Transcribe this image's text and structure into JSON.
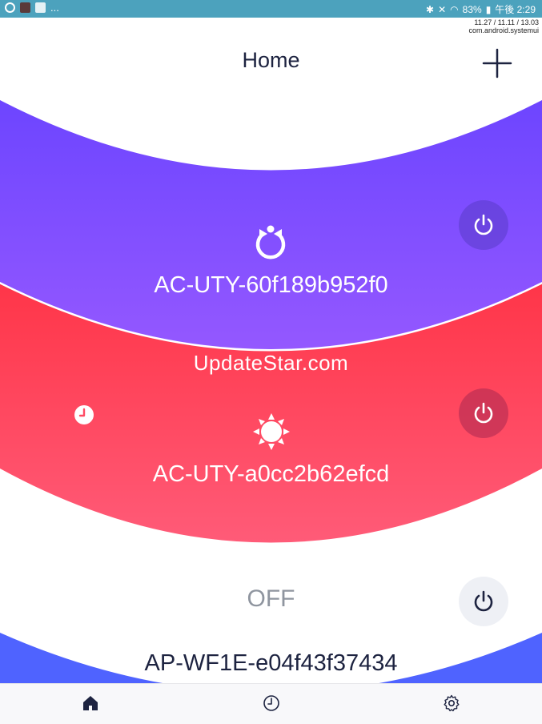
{
  "status_bar": {
    "left_more": "...",
    "battery": "83%",
    "clock": "午後 2:29"
  },
  "overlay": {
    "line1": "11.27 / 11.11 / 13.03",
    "line2": "com.android.systemui"
  },
  "header": {
    "title": "Home",
    "add_icon": "plus-icon"
  },
  "devices": [
    {
      "name": "AC-UTY-60f189b952f0",
      "mode_icon": "auto-mode-icon",
      "power_icon": "power-icon",
      "color": "#7a4cff"
    },
    {
      "name": "AC-UTY-a0cc2b62efcd",
      "mode_icon": "heat-mode-icon",
      "timer_icon": "clock-icon",
      "power_icon": "power-icon",
      "color": "#ff4a63"
    },
    {
      "name": "AP-WF1E-e04f43f37434",
      "state": "OFF",
      "power_icon": "power-icon",
      "color": "#ffffff"
    }
  ],
  "watermark": "UpdateStar.com",
  "bottom_nav": {
    "home_icon": "home-icon",
    "history_icon": "clock-icon",
    "settings_icon": "gear-icon"
  },
  "colors": {
    "status_bar": "#4ca2bd",
    "purple": "#7a4cff",
    "red": "#ff4a63",
    "text_dark": "#1d2340",
    "text_off": "#8f959f"
  }
}
